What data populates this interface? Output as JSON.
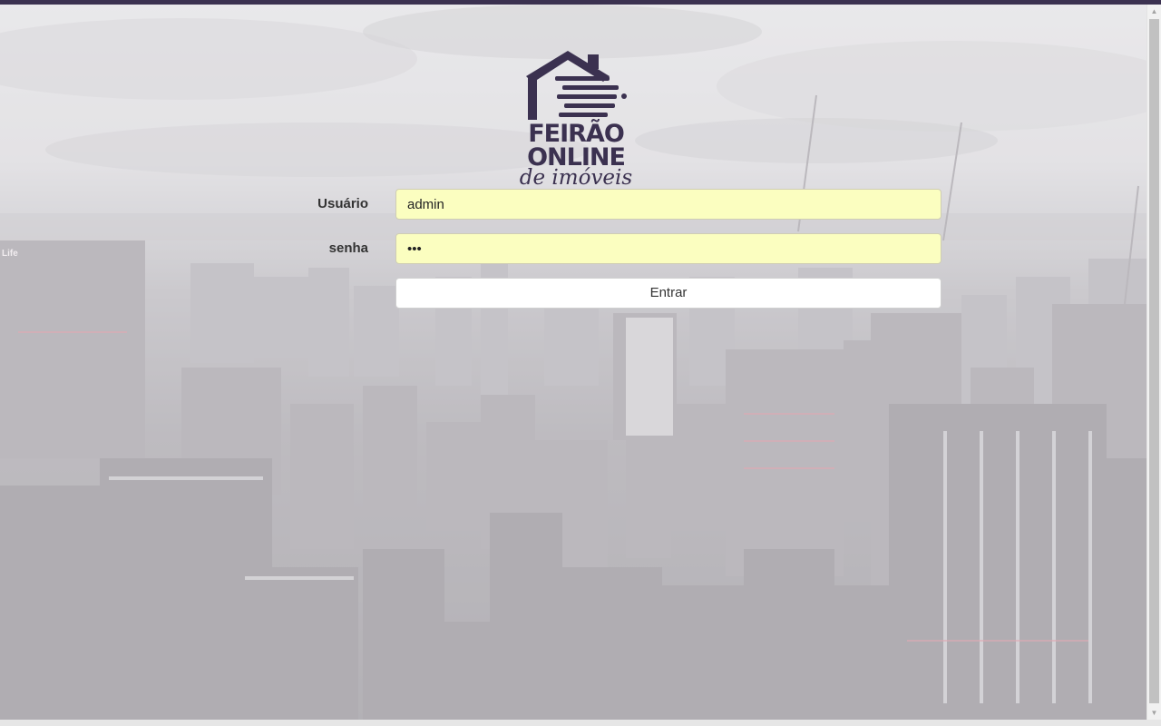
{
  "logo": {
    "line1": "FEIRÃO",
    "line2": "ONLINE",
    "line3": "de imóveis",
    "color": "#3b3150"
  },
  "login": {
    "username_label": "Usuário",
    "username_value": "admin",
    "password_label": "senha",
    "password_value": "•••",
    "submit_label": "Entrar",
    "input_autofill_color": "#fbfec0"
  },
  "background": {
    "sign_text": "Life"
  },
  "theme": {
    "accent": "#3b3150"
  }
}
